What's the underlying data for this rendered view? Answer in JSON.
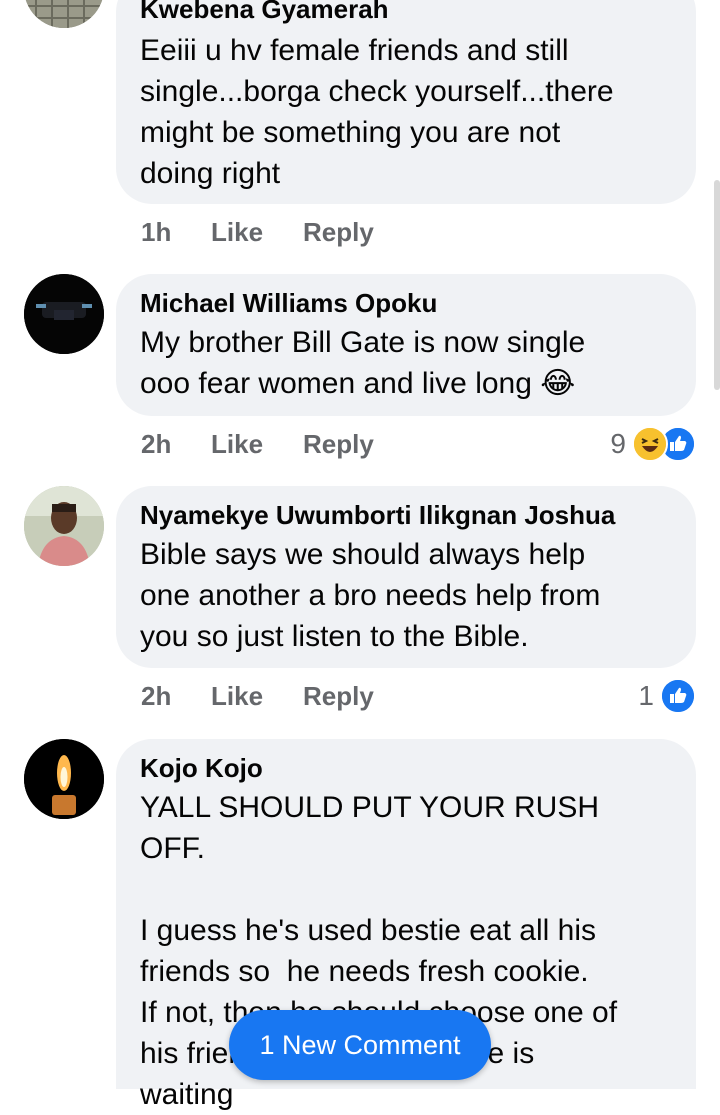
{
  "comments": [
    {
      "author": "Kwebena Gyamerah",
      "text": "Eeiii u hv female friends and still\nsingle...borga check yourself...there\nmight be something you are not\ndoing right",
      "time": "1h",
      "like": "Like",
      "reply": "Reply",
      "reactions": null
    },
    {
      "author": "Michael Williams Opoku",
      "text": "My brother Bill Gate is now single\nooo fear women and live long 😂",
      "time": "2h",
      "like": "Like",
      "reply": "Reply",
      "reactions": {
        "count": "9",
        "icons": [
          "haha-icon",
          "like-icon"
        ]
      }
    },
    {
      "author": "Nyamekye Uwumborti Ilikgnan Joshua",
      "text": "Bible says we should always help\none another a bro needs help from\nyou so just listen to the Bible.",
      "time": "2h",
      "like": "Like",
      "reply": "Reply",
      "reactions": {
        "count": "1",
        "icons": [
          "like-icon"
        ]
      }
    },
    {
      "author": "Kojo Kojo",
      "text": "YALL SHOULD PUT YOUR RUSH OFF.\n\nI guess he's used bestie eat all his\nfriends so  he needs fresh cookie.\nIf not, then he should choose one of\nhis friends coz I'm sure one is\nwaiting"
    }
  ],
  "new_comment_button": "1 New Comment",
  "colors": {
    "bubble": "#f0f2f5",
    "accent": "#1877f2",
    "meta": "#65676b"
  }
}
